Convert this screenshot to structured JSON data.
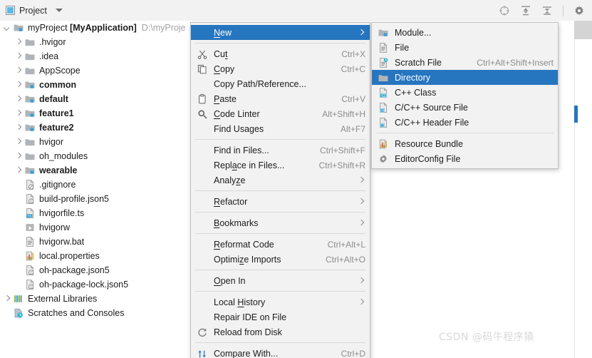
{
  "toolbar": {
    "title": "Project",
    "icons": [
      {
        "name": "project-panel-icon"
      },
      {
        "name": "chevron-down-icon"
      },
      {
        "name": "scroll-from-source-icon"
      },
      {
        "name": "expand-all-icon"
      },
      {
        "name": "collapse-all-icon"
      },
      {
        "name": "gear-icon"
      }
    ]
  },
  "tree": {
    "rows": [
      {
        "label": "myProject [MyApplication]",
        "name_plain": "myProject ",
        "name_bold": "[MyApplication]",
        "path": "D:\\myProje",
        "icon": "module-folder-icon",
        "indent": 0,
        "arrow": "down",
        "bold": false
      },
      {
        "label": ".hvigor",
        "icon": "folder-icon",
        "indent": 1,
        "arrow": "right",
        "bold": false
      },
      {
        "label": ".idea",
        "icon": "folder-icon",
        "indent": 1,
        "arrow": "right",
        "bold": false
      },
      {
        "label": "AppScope",
        "icon": "folder-icon",
        "indent": 1,
        "arrow": "right",
        "bold": false
      },
      {
        "label": "common",
        "icon": "module-folder-icon",
        "indent": 1,
        "arrow": "right",
        "bold": true
      },
      {
        "label": "default",
        "icon": "module-folder-icon",
        "indent": 1,
        "arrow": "right",
        "bold": true
      },
      {
        "label": "feature1",
        "icon": "module-folder-icon",
        "indent": 1,
        "arrow": "right",
        "bold": true
      },
      {
        "label": "feature2",
        "icon": "module-folder-icon",
        "indent": 1,
        "arrow": "right",
        "bold": true
      },
      {
        "label": "hvigor",
        "icon": "folder-icon",
        "indent": 1,
        "arrow": "right",
        "bold": false
      },
      {
        "label": "oh_modules",
        "icon": "folder-icon",
        "indent": 1,
        "arrow": "right",
        "bold": false
      },
      {
        "label": "wearable",
        "icon": "module-folder-icon",
        "indent": 1,
        "arrow": "right",
        "bold": true
      },
      {
        "label": ".gitignore",
        "icon": "gitignore-file-icon",
        "indent": 1,
        "arrow": "none",
        "bold": false
      },
      {
        "label": "build-profile.json5",
        "icon": "json-file-icon",
        "indent": 1,
        "arrow": "none",
        "bold": false
      },
      {
        "label": "hvigorfile.ts",
        "icon": "typescript-file-icon",
        "indent": 1,
        "arrow": "none",
        "bold": false
      },
      {
        "label": "hvigorw",
        "icon": "script-file-icon",
        "indent": 1,
        "arrow": "none",
        "bold": false
      },
      {
        "label": "hvigorw.bat",
        "icon": "text-file-icon",
        "indent": 1,
        "arrow": "none",
        "bold": false
      },
      {
        "label": "local.properties",
        "icon": "properties-file-icon",
        "indent": 1,
        "arrow": "none",
        "bold": false
      },
      {
        "label": "oh-package.json5",
        "icon": "json-file-icon",
        "indent": 1,
        "arrow": "none",
        "bold": false
      },
      {
        "label": "oh-package-lock.json5",
        "icon": "json-file-icon",
        "indent": 1,
        "arrow": "none",
        "bold": false
      },
      {
        "label": "External Libraries",
        "icon": "external-libraries-icon",
        "indent": 0,
        "arrow": "right",
        "bold": false
      },
      {
        "label": "Scratches and Consoles",
        "icon": "scratches-icon",
        "indent": 0,
        "arrow": "none",
        "bold": false
      }
    ]
  },
  "context_menu": {
    "items": [
      {
        "type": "item",
        "label": "New",
        "accel": "",
        "icon": "",
        "submenu": true,
        "selected": true,
        "mnemonic": "N"
      },
      {
        "type": "sep"
      },
      {
        "type": "item",
        "label": "Cut",
        "accel": "Ctrl+X",
        "icon": "scissors-icon",
        "submenu": false,
        "selected": false,
        "mnemonic": "t"
      },
      {
        "type": "item",
        "label": "Copy",
        "accel": "Ctrl+C",
        "icon": "copy-icon",
        "submenu": false,
        "selected": false,
        "mnemonic": "C"
      },
      {
        "type": "item",
        "label": "Copy Path/Reference...",
        "accel": "",
        "icon": "",
        "submenu": false,
        "selected": false
      },
      {
        "type": "item",
        "label": "Paste",
        "accel": "Ctrl+V",
        "icon": "clipboard-icon",
        "submenu": false,
        "selected": false,
        "mnemonic": "P"
      },
      {
        "type": "item",
        "label": "Code Linter",
        "accel": "Alt+Shift+H",
        "icon": "code-linter-icon",
        "submenu": false,
        "selected": false,
        "mnemonic": "C"
      },
      {
        "type": "item",
        "label": "Find Usages",
        "accel": "Alt+F7",
        "icon": "",
        "submenu": false,
        "selected": false
      },
      {
        "type": "sep"
      },
      {
        "type": "item",
        "label": "Find in Files...",
        "accel": "Ctrl+Shift+F",
        "icon": "",
        "submenu": false,
        "selected": false
      },
      {
        "type": "item",
        "label": "Replace in Files...",
        "accel": "Ctrl+Shift+R",
        "icon": "",
        "submenu": false,
        "selected": false,
        "mnemonic": "a"
      },
      {
        "type": "item",
        "label": "Analyze",
        "accel": "",
        "icon": "",
        "submenu": true,
        "selected": false,
        "mnemonic": "z"
      },
      {
        "type": "sep"
      },
      {
        "type": "item",
        "label": "Refactor",
        "accel": "",
        "icon": "",
        "submenu": true,
        "selected": false,
        "mnemonic": "R"
      },
      {
        "type": "sep"
      },
      {
        "type": "item",
        "label": "Bookmarks",
        "accel": "",
        "icon": "",
        "submenu": true,
        "selected": false,
        "mnemonic": "B"
      },
      {
        "type": "sep"
      },
      {
        "type": "item",
        "label": "Reformat Code",
        "accel": "Ctrl+Alt+L",
        "icon": "",
        "submenu": false,
        "selected": false,
        "mnemonic": "R"
      },
      {
        "type": "item",
        "label": "Optimize Imports",
        "accel": "Ctrl+Alt+O",
        "icon": "",
        "submenu": false,
        "selected": false,
        "mnemonic": "z"
      },
      {
        "type": "sep"
      },
      {
        "type": "item",
        "label": "Open In",
        "accel": "",
        "icon": "",
        "submenu": true,
        "selected": false,
        "mnemonic": "O"
      },
      {
        "type": "sep"
      },
      {
        "type": "item",
        "label": "Local History",
        "accel": "",
        "icon": "",
        "submenu": true,
        "selected": false,
        "mnemonic": "H"
      },
      {
        "type": "item",
        "label": "Repair IDE on File",
        "accel": "",
        "icon": "",
        "submenu": false,
        "selected": false
      },
      {
        "type": "item",
        "label": "Reload from Disk",
        "accel": "",
        "icon": "reload-icon",
        "submenu": false,
        "selected": false
      },
      {
        "type": "sep"
      },
      {
        "type": "item",
        "label": "Compare With...",
        "accel": "Ctrl+D",
        "icon": "compare-icon",
        "submenu": false,
        "selected": false
      }
    ]
  },
  "submenu": {
    "items": [
      {
        "type": "item",
        "label": "Module...",
        "accel": "",
        "icon": "module-folder-icon",
        "selected": false
      },
      {
        "type": "item",
        "label": "File",
        "accel": "",
        "icon": "text-file-icon",
        "selected": false
      },
      {
        "type": "item",
        "label": "Scratch File",
        "accel": "Ctrl+Alt+Shift+Insert",
        "icon": "scratch-file-icon",
        "selected": false
      },
      {
        "type": "item",
        "label": "Directory",
        "accel": "",
        "icon": "folder-icon",
        "selected": true
      },
      {
        "type": "item",
        "label": "C++ Class",
        "accel": "",
        "icon": "cpp-class-icon",
        "selected": false
      },
      {
        "type": "item",
        "label": "C/C++ Source File",
        "accel": "",
        "icon": "c-source-file-icon",
        "selected": false
      },
      {
        "type": "item",
        "label": "C/C++ Header File",
        "accel": "",
        "icon": "c-header-file-icon",
        "selected": false
      },
      {
        "type": "sep"
      },
      {
        "type": "item",
        "label": "Resource Bundle",
        "accel": "",
        "icon": "resource-bundle-icon",
        "selected": false
      },
      {
        "type": "item",
        "label": "EditorConfig File",
        "accel": "",
        "icon": "gear-icon",
        "selected": false
      }
    ]
  },
  "watermark": {
    "text": "CSDN @码牛程序猿"
  },
  "colors": {
    "selection": "#2675bf",
    "menu_bg": "#f2f2f2",
    "toolbar_bg": "#f2f2f2",
    "accent_blue": "#389fd6",
    "path_gray": "#a2a2a2"
  }
}
